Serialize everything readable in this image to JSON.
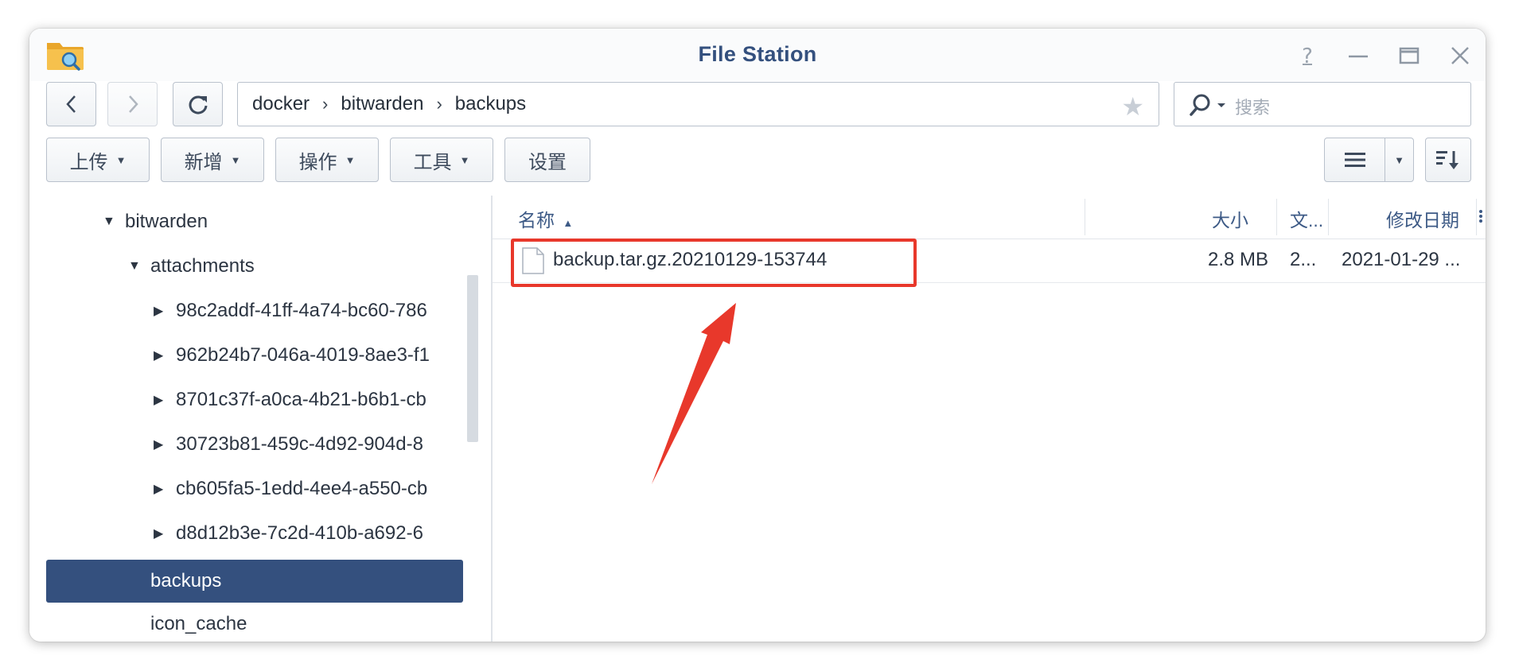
{
  "window": {
    "title": "File Station",
    "controls": [
      "help-icon",
      "minimize-icon",
      "maximize-icon",
      "close-icon"
    ]
  },
  "nav": {
    "back_icon": "chevron-left-icon",
    "forward_icon": "chevron-right-icon",
    "refresh_icon": "refresh-icon"
  },
  "path": {
    "segments": [
      "docker",
      "bitwarden",
      "backups"
    ],
    "separator": "›",
    "favorite_icon": "star-icon"
  },
  "search": {
    "placeholder": "搜索"
  },
  "toolbar": {
    "upload": "上传",
    "create": "新增",
    "action": "操作",
    "tools": "工具",
    "settings": "设置",
    "view_icon": "list-view-icon",
    "sort_icon": "sort-icon"
  },
  "sidebar": {
    "items": [
      {
        "label": "bitwarden",
        "expanded": true
      },
      {
        "label": "attachments",
        "expanded": true
      },
      {
        "label": "98c2addf-41ff-4a74-bc60-786",
        "expanded": false
      },
      {
        "label": "962b24b7-046a-4019-8ae3-f1",
        "expanded": false
      },
      {
        "label": "8701c37f-a0ca-4b21-b6b1-cb",
        "expanded": false
      },
      {
        "label": "30723b81-459c-4d92-904d-8",
        "expanded": false
      },
      {
        "label": "cb605fa5-1edd-4ee4-a550-cb",
        "expanded": false
      },
      {
        "label": "d8d12b3e-7c2d-410b-a692-6",
        "expanded": false
      },
      {
        "label": "backups",
        "selected": true
      },
      {
        "label": "icon_cache"
      }
    ]
  },
  "list": {
    "columns": {
      "name": "名称",
      "size": "大小",
      "type": "文...",
      "modified": "修改日期"
    },
    "sort_indicator": "▲",
    "rows": [
      {
        "name": "backup.tar.gz.20210129-153744",
        "size": "2.8 MB",
        "type": "2...",
        "modified": "2021-01-29 ..."
      }
    ]
  },
  "colors": {
    "accent": "#34507e",
    "annotation": "#e8382b"
  }
}
